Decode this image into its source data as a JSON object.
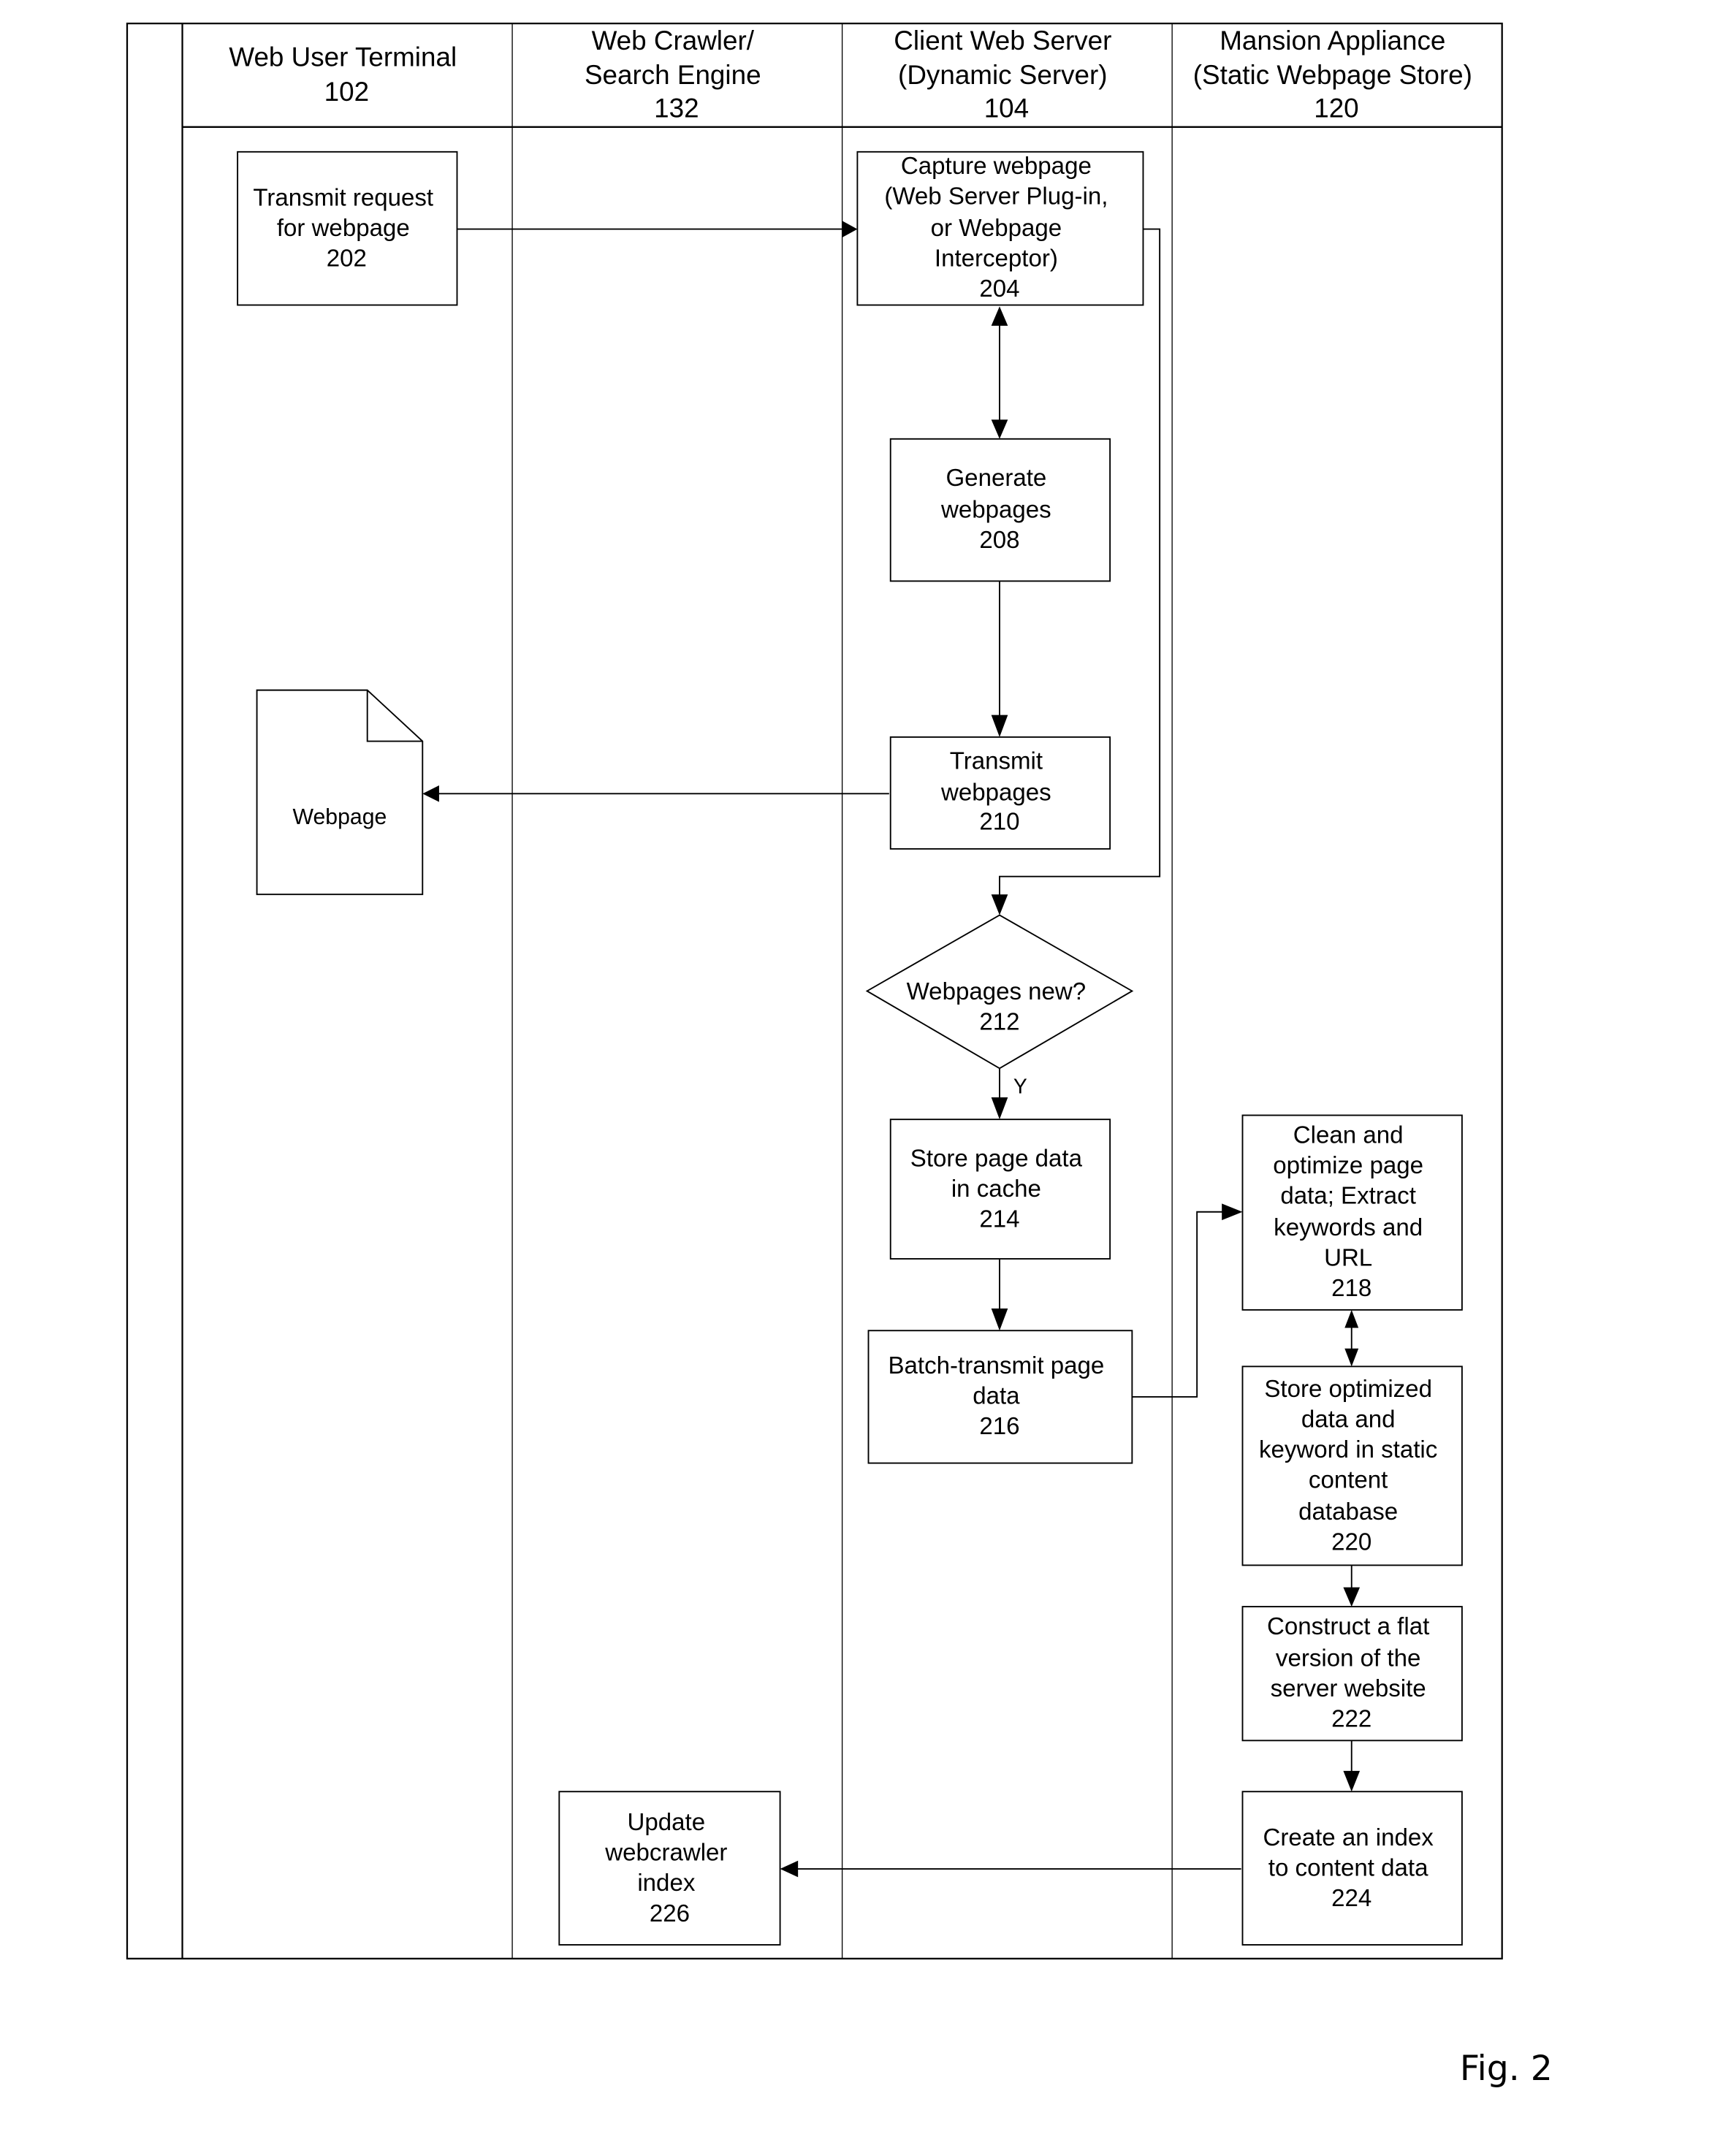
{
  "figure": {
    "label": "Fig. 2"
  },
  "lanes": [
    {
      "id": "web-user-terminal",
      "title": [
        "Web User Terminal",
        "102"
      ]
    },
    {
      "id": "web-crawler",
      "title": [
        "Web Crawler/",
        "Search Engine",
        "132"
      ]
    },
    {
      "id": "client-web-server",
      "title": [
        "Client Web Server",
        "(Dynamic Server)",
        "104"
      ]
    },
    {
      "id": "mansion-appliance",
      "title": [
        "Mansion Appliance",
        "(Static Webpage Store)",
        "120"
      ]
    }
  ],
  "steps": {
    "s202": {
      "lines": [
        "Transmit request",
        "for webpage",
        "202"
      ]
    },
    "s204": {
      "lines": [
        "Capture webpage",
        "(Web Server Plug-in,",
        "or Webpage",
        "Interceptor)",
        "204"
      ]
    },
    "s208": {
      "lines": [
        "Generate",
        "webpages",
        "208"
      ]
    },
    "s210": {
      "lines": [
        "Transmit",
        "webpages",
        "210"
      ]
    },
    "s212": {
      "lines": [
        "Webpages new?",
        "212"
      ],
      "type": "decision",
      "yes_label": "Y"
    },
    "s214": {
      "lines": [
        "Store page data",
        "in cache",
        "214"
      ]
    },
    "s216": {
      "lines": [
        "Batch-transmit page",
        "data",
        "216"
      ]
    },
    "s218": {
      "lines": [
        "Clean and",
        "optimize page",
        "data; Extract",
        "keywords and",
        "URL",
        "218"
      ]
    },
    "s220": {
      "lines": [
        "Store optimized",
        "data and",
        "keyword in static",
        "content",
        "database",
        "220"
      ]
    },
    "s222": {
      "lines": [
        "Construct a flat",
        "version of the",
        "server website",
        "222"
      ]
    },
    "s224": {
      "lines": [
        "Create an index",
        "to content data",
        "224"
      ]
    },
    "s226": {
      "lines": [
        "Update",
        "webcrawler",
        "index",
        "226"
      ]
    }
  },
  "webpage_document": {
    "label": "Webpage"
  }
}
